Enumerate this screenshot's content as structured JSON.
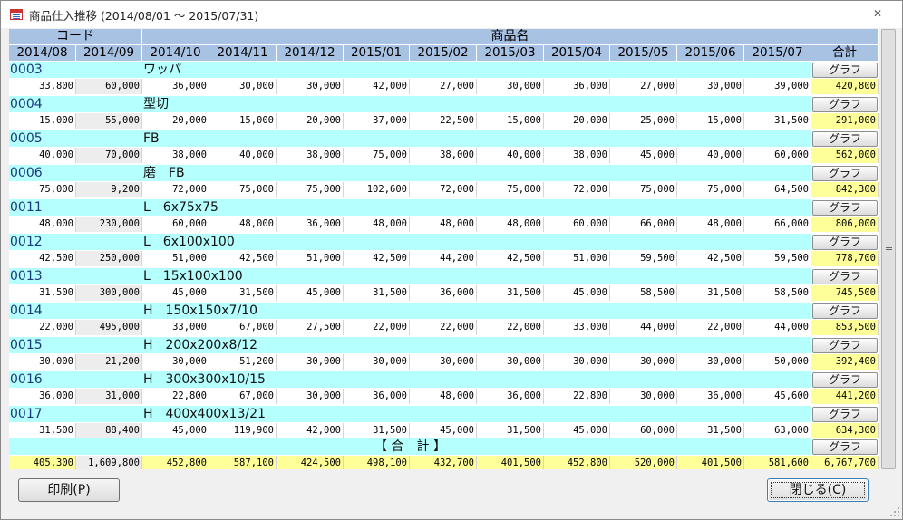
{
  "window": {
    "title": "商品仕入推移 (2014/08/01 ～ 2015/07/31)",
    "close_glyph": "✕"
  },
  "header": {
    "code_label": "コード",
    "name_label": "商品名",
    "months": [
      "2014/08",
      "2014/09",
      "2014/10",
      "2014/11",
      "2014/12",
      "2015/01",
      "2015/02",
      "2015/03",
      "2015/04",
      "2015/05",
      "2015/06",
      "2015/07"
    ],
    "total_label": "合計"
  },
  "graph_button_label": "グラフ",
  "rows": [
    {
      "code": "0003",
      "name": "ワッパ",
      "values": [
        "33,800",
        "60,000",
        "36,000",
        "30,000",
        "30,000",
        "42,000",
        "27,000",
        "30,000",
        "36,000",
        "27,000",
        "30,000",
        "39,000"
      ],
      "total": "420,800"
    },
    {
      "code": "0004",
      "name": "型切",
      "values": [
        "15,000",
        "55,000",
        "20,000",
        "15,000",
        "20,000",
        "37,000",
        "22,500",
        "15,000",
        "20,000",
        "25,000",
        "15,000",
        "31,500"
      ],
      "total": "291,000"
    },
    {
      "code": "0005",
      "name": "FB",
      "values": [
        "40,000",
        "70,000",
        "38,000",
        "40,000",
        "38,000",
        "75,000",
        "38,000",
        "40,000",
        "38,000",
        "45,000",
        "40,000",
        "60,000"
      ],
      "total": "562,000"
    },
    {
      "code": "0006",
      "name": "磨　FB",
      "values": [
        "75,000",
        "9,200",
        "72,000",
        "75,000",
        "75,000",
        "102,600",
        "72,000",
        "75,000",
        "72,000",
        "75,000",
        "75,000",
        "64,500"
      ],
      "total": "842,300"
    },
    {
      "code": "0011",
      "name": "L　6x75x75",
      "values": [
        "48,000",
        "230,000",
        "60,000",
        "48,000",
        "36,000",
        "48,000",
        "48,000",
        "48,000",
        "60,000",
        "66,000",
        "48,000",
        "66,000"
      ],
      "total": "806,000"
    },
    {
      "code": "0012",
      "name": "L　6x100x100",
      "values": [
        "42,500",
        "250,000",
        "51,000",
        "42,500",
        "51,000",
        "42,500",
        "44,200",
        "42,500",
        "51,000",
        "59,500",
        "42,500",
        "59,500"
      ],
      "total": "778,700"
    },
    {
      "code": "0013",
      "name": "L　15x100x100",
      "values": [
        "31,500",
        "300,000",
        "45,000",
        "31,500",
        "45,000",
        "31,500",
        "36,000",
        "31,500",
        "45,000",
        "58,500",
        "31,500",
        "58,500"
      ],
      "total": "745,500"
    },
    {
      "code": "0014",
      "name": "H　150x150x7/10",
      "values": [
        "22,000",
        "495,000",
        "33,000",
        "67,000",
        "27,500",
        "22,000",
        "22,000",
        "22,000",
        "33,000",
        "44,000",
        "22,000",
        "44,000"
      ],
      "total": "853,500"
    },
    {
      "code": "0015",
      "name": "H　200x200x8/12",
      "values": [
        "30,000",
        "21,200",
        "30,000",
        "51,200",
        "30,000",
        "30,000",
        "30,000",
        "30,000",
        "30,000",
        "30,000",
        "30,000",
        "50,000"
      ],
      "total": "392,400"
    },
    {
      "code": "0016",
      "name": "H　300x300x10/15",
      "values": [
        "36,000",
        "31,000",
        "22,800",
        "67,000",
        "30,000",
        "36,000",
        "48,000",
        "36,000",
        "22,800",
        "30,000",
        "36,000",
        "45,600"
      ],
      "total": "441,200"
    },
    {
      "code": "0017",
      "name": "H　400x400x13/21",
      "values": [
        "31,500",
        "88,400",
        "45,000",
        "119,900",
        "42,000",
        "31,500",
        "45,000",
        "31,500",
        "45,000",
        "60,000",
        "31,500",
        "63,000"
      ],
      "total": "634,300"
    }
  ],
  "summary": {
    "label": "【 合　計 】",
    "values": [
      "405,300",
      "1,609,800",
      "452,800",
      "587,100",
      "424,500",
      "498,100",
      "432,700",
      "401,500",
      "452,800",
      "520,000",
      "401,500",
      "581,600"
    ],
    "total": "6,767,700"
  },
  "footer": {
    "print_label": "印刷(P)",
    "close_label": "閉じる(C)"
  },
  "colors": {
    "header": "#a8c2e4",
    "band": "#b6ffff",
    "total": "#ffff99"
  }
}
